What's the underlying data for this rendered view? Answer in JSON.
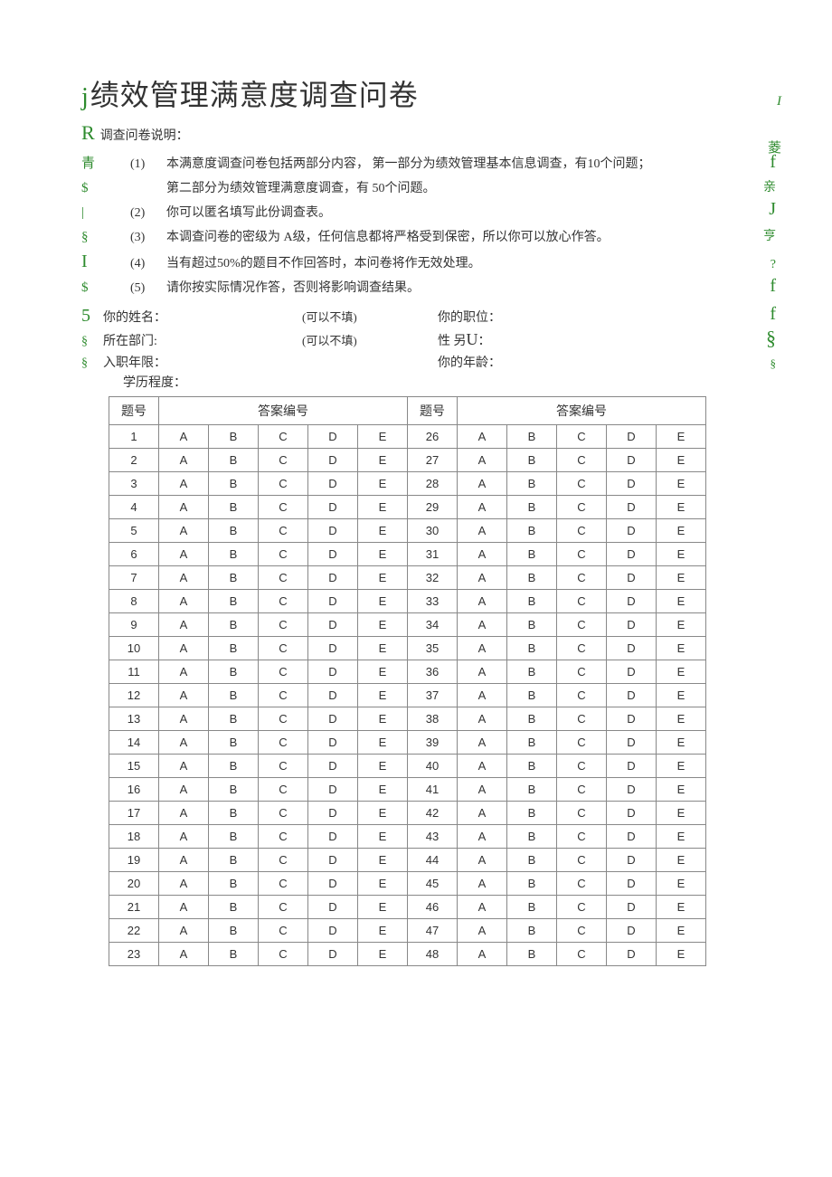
{
  "markers": {
    "title_prefix": "j",
    "title_right": "I",
    "subtitle_prefix": "R",
    "subtitle_right": "菱",
    "row1_left": "青",
    "row1_right": "f",
    "row1b_left": "$",
    "row1b_right": "亲",
    "row2_left": "|",
    "row2_right": "J",
    "row3_left": "§",
    "row3_right": "亨",
    "row4_left": "I",
    "row4_right": "?",
    "row5_left": "$",
    "row5_right": "f",
    "field1_left": "5",
    "field1_right": "f",
    "field2_left": "§",
    "field2_right": "§",
    "field3_left": "§",
    "field3_right": "§"
  },
  "title": "绩效管理满意度调查问卷",
  "subtitle": "调查问卷说明：",
  "instructions": {
    "n1": "(1)",
    "t1a": "本满意度调查问卷包括两部分内容，   第一部分为绩效管理基本信息调查，有10个问题；",
    "t1b": "第二部分为绩效管理满意度调查，有 50个问题。",
    "n2": "(2)",
    "t2": "你可以匿名填写此份调查表。",
    "n3": "(3)",
    "t3": "本调查问卷的密级为 A级，任何信息都将严格受到保密，所以你可以放心作答。",
    "n4": "(4)",
    "t4": "当有超过50%的题目不作回答时，本问卷将作无效处理。",
    "n5": "(5)",
    "t5": "请你按实际情况作答，否则将影响调查结果。"
  },
  "fields": {
    "name_label": "你的姓名：",
    "name_note": "(可以不填)",
    "position_label": "你的职位：",
    "dept_label": "所在部门:",
    "dept_note": "(可以不填)",
    "gender_label_a": "性 另",
    "gender_label_b": "U",
    "gender_label_c": "：",
    "tenure_label": "入职年限：",
    "age_label": "你的年龄：",
    "edu_label": "学历程度："
  },
  "table": {
    "header_num": "题号",
    "header_ans": "答案编号",
    "options": [
      "A",
      "B",
      "C",
      "D",
      "E"
    ],
    "left_start": 1,
    "right_start": 26,
    "rows": 23
  }
}
